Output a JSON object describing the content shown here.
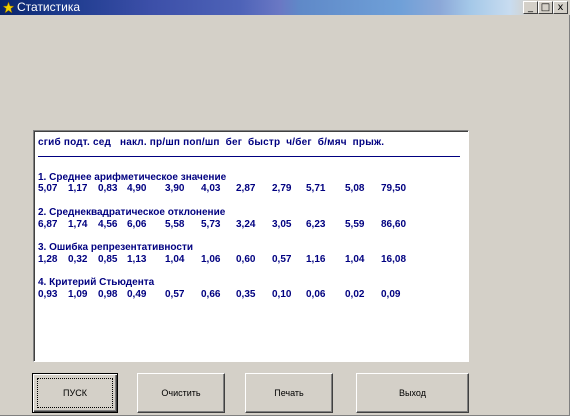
{
  "window": {
    "title": "Статистика",
    "controls": {
      "minimize": "_",
      "maximize": "□",
      "close": "x"
    }
  },
  "results": {
    "header": "сгиб подт. сед   накл. пр/шп поп/шп  бег  быстр  ч/бег  б/мяч  прыж.",
    "sections": [
      {
        "title": "1. Среднее арифметическое значение",
        "values": [
          "5,07",
          "1,17",
          "0,83",
          "4,90",
          "3,90",
          "4,03",
          "2,87",
          "2,79",
          "5,71",
          "5,08",
          "79,50"
        ]
      },
      {
        "title": "2. Среднеквадратическое отклонение",
        "values": [
          "6,87",
          "1,74",
          "4,56",
          "6,06",
          "5,58",
          "5,73",
          "3,24",
          "3,05",
          "6,23",
          "5,59",
          "86,60"
        ]
      },
      {
        "title": "3. Ошибка репрезентативности",
        "values": [
          "1,28",
          "0,32",
          "0,85",
          "1,13",
          "1,04",
          "1,06",
          "0,60",
          "0,57",
          "1,16",
          "1,04",
          "16,08"
        ]
      },
      {
        "title": "4. Критерий Стьюдента",
        "values": [
          "0,93",
          "1,09",
          "0,98",
          "0,49",
          "0,57",
          "0,66",
          "0,35",
          "0,10",
          "0,06",
          "0,02",
          "0,09"
        ]
      }
    ]
  },
  "buttons": {
    "start": "ПУСК",
    "clear": "Очистить",
    "print": "Печать",
    "exit": "Выход"
  },
  "colors": {
    "text": "#000080",
    "face": "#d4d0c8",
    "title_start": "#08246b"
  },
  "icons": {
    "app": "app-star-icon"
  }
}
